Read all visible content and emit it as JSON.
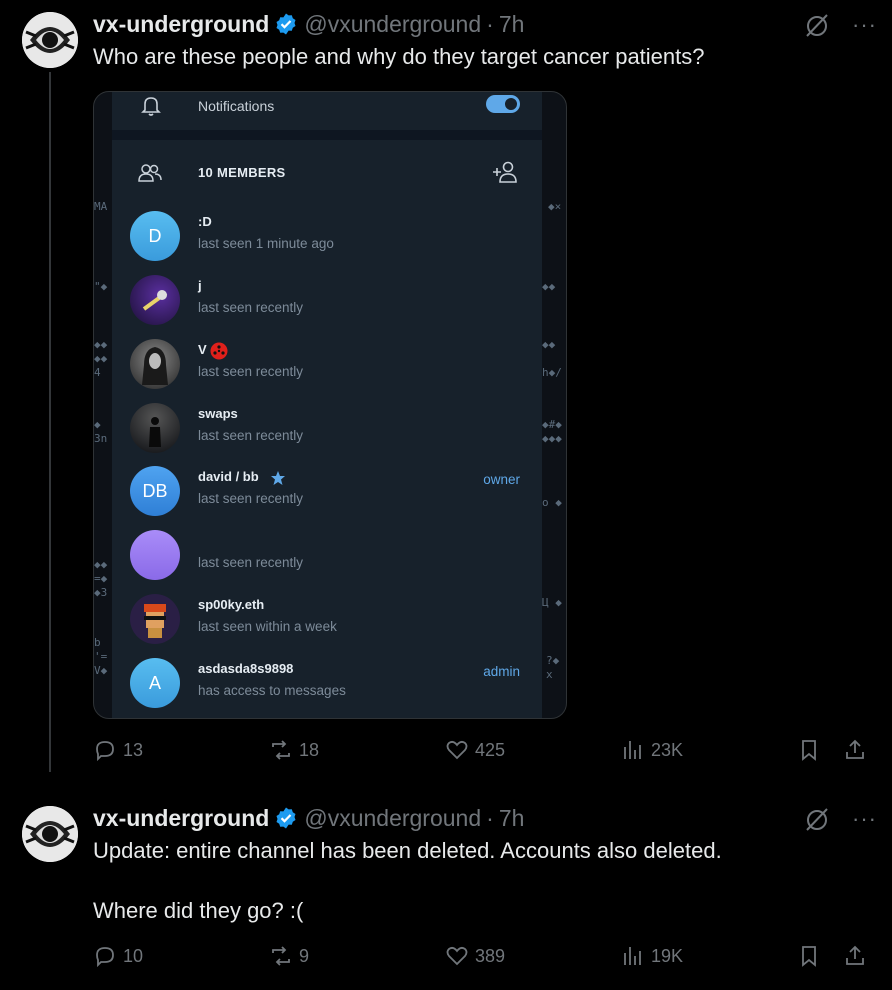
{
  "tweet1": {
    "display_name": "vx-underground",
    "handle": "@vxunderground",
    "dot": "·",
    "time": "7h",
    "text": "Who are these people and why do they target cancer patients?",
    "more": "···",
    "metrics": {
      "replies": "13",
      "reposts": "18",
      "likes": "425",
      "views": "23K"
    }
  },
  "screenshot": {
    "notifications_label": "Notifications",
    "notifications_on": true,
    "members_label": "10 MEMBERS",
    "members": [
      {
        "initials": "D",
        "name": ":D",
        "status": "last seen 1 minute ago",
        "role": "",
        "color": "#4fb0e8",
        "avatar_type": "initials"
      },
      {
        "initials": "",
        "name": "j",
        "status": "last seen recently",
        "role": "",
        "color": "#2b1a4f",
        "avatar_type": "image"
      },
      {
        "initials": "",
        "name": "V",
        "status": "last seen recently",
        "role": "",
        "color": "#444",
        "avatar_type": "image"
      },
      {
        "initials": "",
        "name": "swaps",
        "status": "last seen recently",
        "role": "",
        "color": "#1a1d22",
        "avatar_type": "image"
      },
      {
        "initials": "DB",
        "name": "david / bb",
        "status": "last seen recently",
        "role": "owner",
        "color": "#3d8fe0",
        "avatar_type": "initials"
      },
      {
        "initials": "",
        "name": "",
        "status": "last seen recently",
        "role": "",
        "color": "#9a7cf0",
        "avatar_type": "initials"
      },
      {
        "initials": "",
        "name": "sp00ky.eth",
        "status": "last seen within a week",
        "role": "",
        "color": "#3b2a5e",
        "avatar_type": "image"
      },
      {
        "initials": "A",
        "name": "asdasda8s9898",
        "status": "has access to messages",
        "role": "admin",
        "color": "#4fb0e8",
        "avatar_type": "initials"
      }
    ]
  },
  "tweet2": {
    "display_name": "vx-underground",
    "handle": "@vxunderground",
    "dot": "·",
    "time": "7h",
    "text_line1": "Update: entire channel has been deleted. Accounts also deleted.",
    "text_line2": "Where did they go? :(",
    "more": "···",
    "metrics": {
      "replies": "10",
      "reposts": "9",
      "likes": "389",
      "views": "19K"
    }
  },
  "colors": {
    "background": "#000000",
    "verified": "#1d9bf0",
    "muted": "#71767b",
    "link": "#5fa8e8"
  }
}
